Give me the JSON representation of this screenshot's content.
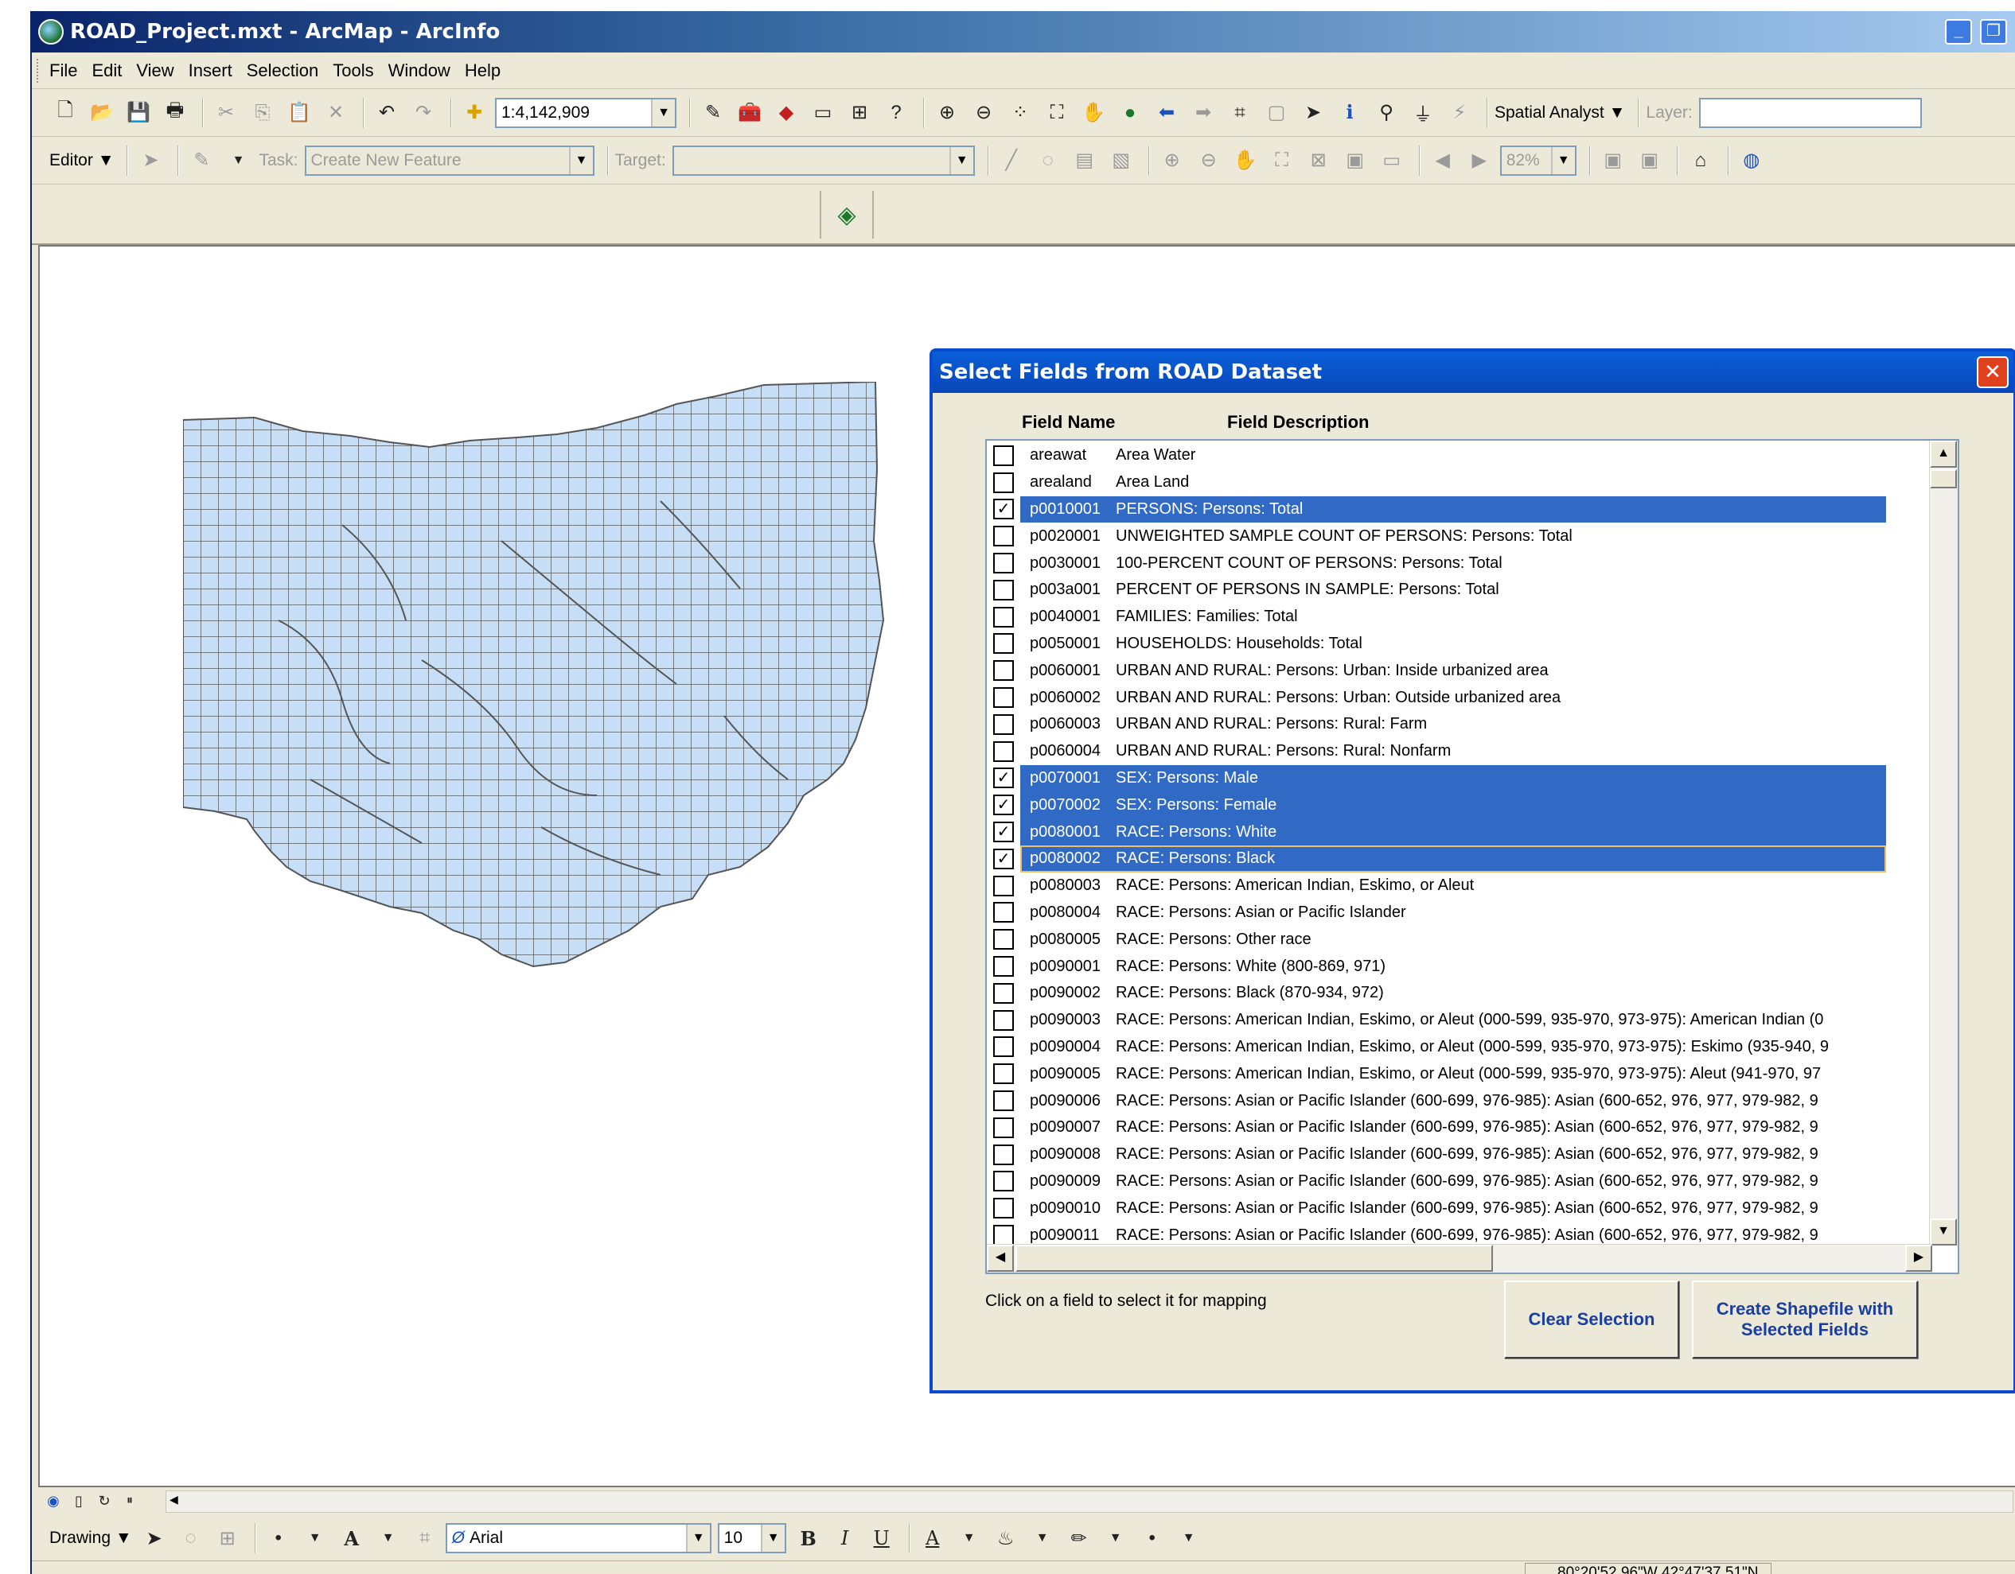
{
  "window": {
    "title": "ROAD_Project.mxt - ArcMap - ArcInfo"
  },
  "menu": [
    "File",
    "Edit",
    "View",
    "Insert",
    "Selection",
    "Tools",
    "Window",
    "Help"
  ],
  "toolbar": {
    "scale_value": "1:4,142,909",
    "spatial_analyst": "Spatial Analyst",
    "layer_label": "Layer:",
    "editor_label": "Editor",
    "task_label": "Task:",
    "task_value": "Create New Feature",
    "target_label": "Target:",
    "zoom_value": "82%"
  },
  "dialog": {
    "title": "Select Fields from ROAD Dataset",
    "col_field_name": "Field Name",
    "col_field_desc": "Field Description",
    "hint": "Click on a field to select it for mapping",
    "clear_button": "Clear Selection",
    "create_button": "Create Shapefile with Selected Fields",
    "fields": [
      {
        "name": "areawat",
        "desc": "Area Water",
        "checked": false
      },
      {
        "name": "arealand",
        "desc": "Area Land",
        "checked": false
      },
      {
        "name": "p0010001",
        "desc": "PERSONS: Persons: Total",
        "checked": true
      },
      {
        "name": "p0020001",
        "desc": "UNWEIGHTED SAMPLE COUNT OF PERSONS: Persons: Total",
        "checked": false
      },
      {
        "name": "p0030001",
        "desc": "100-PERCENT COUNT OF PERSONS: Persons: Total",
        "checked": false
      },
      {
        "name": "p003a001",
        "desc": "PERCENT OF PERSONS IN SAMPLE: Persons: Total",
        "checked": false
      },
      {
        "name": "p0040001",
        "desc": "FAMILIES: Families: Total",
        "checked": false
      },
      {
        "name": "p0050001",
        "desc": "HOUSEHOLDS: Households: Total",
        "checked": false
      },
      {
        "name": "p0060001",
        "desc": "URBAN AND RURAL: Persons: Urban: Inside urbanized area",
        "checked": false
      },
      {
        "name": "p0060002",
        "desc": "URBAN AND RURAL: Persons: Urban: Outside urbanized area",
        "checked": false
      },
      {
        "name": "p0060003",
        "desc": "URBAN AND RURAL: Persons: Rural: Farm",
        "checked": false
      },
      {
        "name": "p0060004",
        "desc": "URBAN AND RURAL: Persons: Rural: Nonfarm",
        "checked": false
      },
      {
        "name": "p0070001",
        "desc": "SEX: Persons: Male",
        "checked": true
      },
      {
        "name": "p0070002",
        "desc": "SEX: Persons: Female",
        "checked": true
      },
      {
        "name": "p0080001",
        "desc": "RACE: Persons: White",
        "checked": true
      },
      {
        "name": "p0080002",
        "desc": "RACE: Persons: Black",
        "checked": true
      },
      {
        "name": "p0080003",
        "desc": "RACE: Persons: American Indian, Eskimo, or Aleut",
        "checked": false
      },
      {
        "name": "p0080004",
        "desc": "RACE: Persons: Asian or Pacific Islander",
        "checked": false
      },
      {
        "name": "p0080005",
        "desc": "RACE: Persons: Other race",
        "checked": false
      },
      {
        "name": "p0090001",
        "desc": "RACE: Persons: White (800-869, 971)",
        "checked": false
      },
      {
        "name": "p0090002",
        "desc": "RACE: Persons: Black (870-934, 972)",
        "checked": false
      },
      {
        "name": "p0090003",
        "desc": "RACE: Persons: American Indian, Eskimo, or Aleut (000-599, 935-970, 973-975): American Indian (0",
        "checked": false
      },
      {
        "name": "p0090004",
        "desc": "RACE: Persons: American Indian, Eskimo, or Aleut (000-599, 935-970, 973-975): Eskimo (935-940, 9",
        "checked": false
      },
      {
        "name": "p0090005",
        "desc": "RACE: Persons: American Indian, Eskimo, or Aleut (000-599, 935-970, 973-975): Aleut (941-970, 97",
        "checked": false
      },
      {
        "name": "p0090006",
        "desc": "RACE: Persons: Asian or Pacific Islander (600-699, 976-985): Asian (600-652, 976, 977, 979-982, 9",
        "checked": false
      },
      {
        "name": "p0090007",
        "desc": "RACE: Persons: Asian or Pacific Islander (600-699, 976-985): Asian (600-652, 976, 977, 979-982, 9",
        "checked": false
      },
      {
        "name": "p0090008",
        "desc": "RACE: Persons: Asian or Pacific Islander (600-699, 976-985): Asian (600-652, 976, 977, 979-982, 9",
        "checked": false
      },
      {
        "name": "p0090009",
        "desc": "RACE: Persons: Asian or Pacific Islander (600-699, 976-985): Asian (600-652, 976, 977, 979-982, 9",
        "checked": false
      },
      {
        "name": "p0090010",
        "desc": "RACE: Persons: Asian or Pacific Islander (600-699, 976-985): Asian (600-652, 976, 977, 979-982, 9",
        "checked": false
      },
      {
        "name": "p0090011",
        "desc": "RACE: Persons: Asian or Pacific Islander (600-699, 976-985): Asian (600-652, 976, 977, 979-982, 9",
        "checked": false
      }
    ]
  },
  "drawing": {
    "label": "Drawing",
    "font": "Arial",
    "font_size": "10"
  },
  "status": {
    "coordinates": "80°20'52.96\"W  42°47'37.51\"N"
  },
  "colors": {
    "selection": "#316ac5",
    "map_fill": "#c6dff7",
    "map_stroke": "#555555"
  }
}
